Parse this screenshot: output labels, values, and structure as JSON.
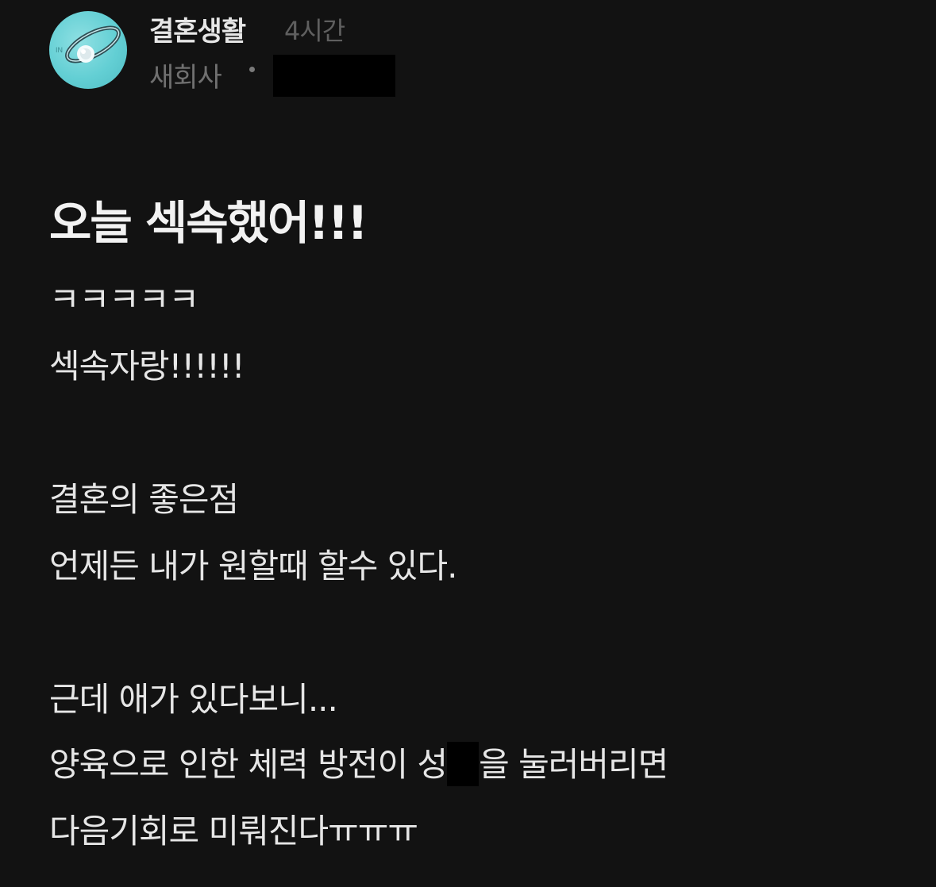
{
  "post_header": {
    "board_name": "결혼생활",
    "time_ago": "4시간",
    "company": "새회사",
    "separator": "·"
  },
  "post": {
    "title": "오늘 섹속했어!!!",
    "lines": [
      "ㅋㅋㅋㅋㅋ",
      "섹속자랑!!!!!!",
      "결혼의 좋은점",
      "언제든 내가 원할때 할수 있다.",
      "근데 애가 있다보니...",
      "양육으로 인한 체력 방전이 성",
      "을 눌러버리면",
      "다음기회로 미뤄진다ㅠㅠㅠ"
    ]
  },
  "colors": {
    "background": "#121212",
    "text": "#e6e6e6",
    "muted": "#707070",
    "avatar": "#63cfd4"
  },
  "icons": {
    "avatar": "ring-photo-icon"
  }
}
